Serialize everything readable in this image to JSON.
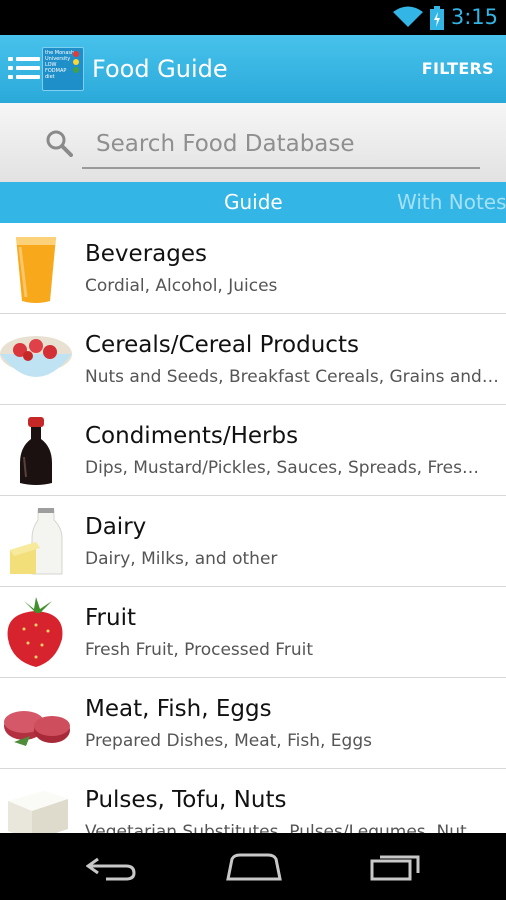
{
  "status_bar": {
    "time": "3:15",
    "icons": [
      "wifi-icon",
      "battery-icon"
    ]
  },
  "action_bar": {
    "title": "Food Guide",
    "filters_label": "FILTERS",
    "logo_text": "the Monash University LOW FODMAP diet",
    "icons": [
      "menu-icon",
      "app-logo"
    ]
  },
  "search": {
    "placeholder": "Search Food Database",
    "value": ""
  },
  "tabs": [
    {
      "label": "Guide",
      "selected": true
    },
    {
      "label": "With Notes",
      "selected": false
    }
  ],
  "categories": [
    {
      "title": "Beverages",
      "subtitle": "Cordial, Alcohol, Juices",
      "icon": "orange-juice-icon"
    },
    {
      "title": "Cereals/Cereal Products",
      "subtitle": "Nuts and Seeds, Breakfast Cereals, Grains and…",
      "icon": "cereal-bowl-icon"
    },
    {
      "title": "Condiments/Herbs",
      "subtitle": "Dips, Mustard/Pickles, Sauces, Spreads, Fres…",
      "icon": "soy-sauce-icon"
    },
    {
      "title": "Dairy",
      "subtitle": "Dairy, Milks, and other",
      "icon": "milk-cheese-icon"
    },
    {
      "title": "Fruit",
      "subtitle": "Fresh Fruit, Processed Fruit",
      "icon": "strawberry-icon"
    },
    {
      "title": "Meat, Fish, Eggs",
      "subtitle": "Prepared Dishes, Meat, Fish, Eggs",
      "icon": "steak-icon"
    },
    {
      "title": "Pulses, Tofu, Nuts",
      "subtitle": "Vegetarian Substitutes, Pulses/Legumes, Nut",
      "icon": "tofu-icon"
    }
  ],
  "nav_bar": {
    "icons": [
      "back-icon",
      "home-icon",
      "recents-icon"
    ]
  },
  "colors": {
    "accent": "#33b5e5",
    "action_bar": "#2aa9d9",
    "status_text": "#33b5e5"
  }
}
